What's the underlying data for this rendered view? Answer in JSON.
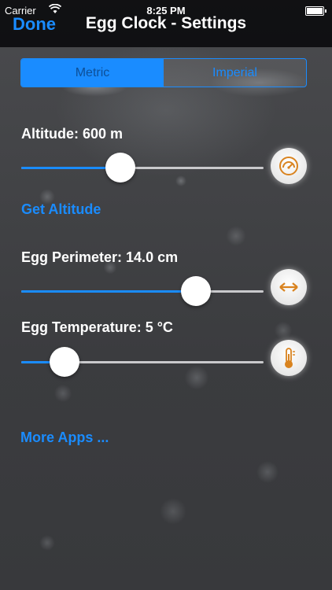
{
  "status": {
    "carrier": "Carrier",
    "time": "8:25 PM"
  },
  "nav": {
    "done": "Done",
    "title": "Egg Clock - Settings"
  },
  "units": {
    "options": [
      "Metric",
      "Imperial"
    ],
    "selected": "Metric"
  },
  "altitude": {
    "label": "Altitude: 600 m",
    "value": 0.41,
    "action": "Get Altitude",
    "icon": "speedometer-icon"
  },
  "perimeter": {
    "label": "Egg Perimeter: 14.0 cm",
    "value": 0.72,
    "icon": "horizontal-arrows-icon"
  },
  "temperature": {
    "label": "Egg Temperature: 5 °C",
    "value": 0.18,
    "icon": "thermometer-icon"
  },
  "more": {
    "label": "More Apps ..."
  },
  "colors": {
    "accent": "#1a8cff",
    "icon": "#d9831f"
  }
}
